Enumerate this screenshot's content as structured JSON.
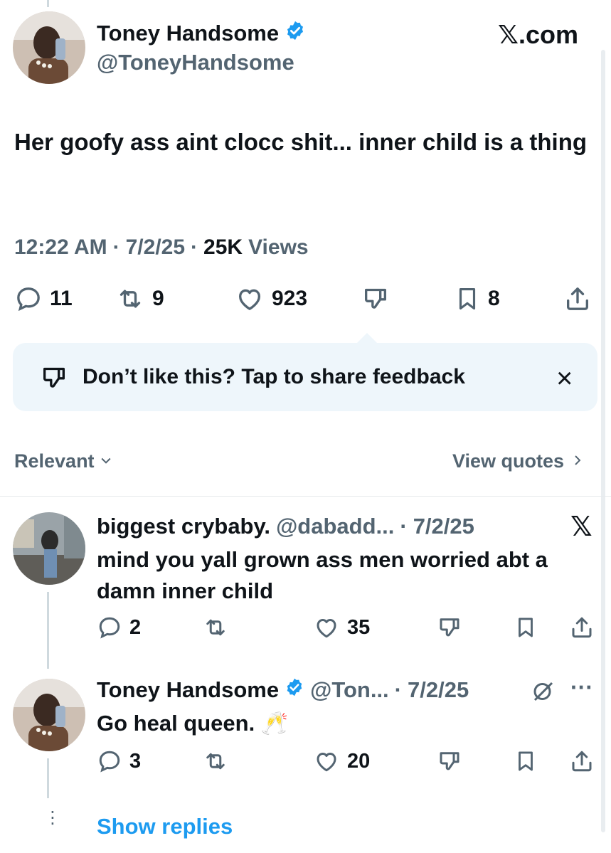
{
  "brand": {
    "site": "𝕏.com"
  },
  "main_post": {
    "author": {
      "name": "Toney Handsome",
      "handle": "@ToneyHandsome",
      "verified": true
    },
    "text": "Her goofy ass aint clocc shit... inner child is a thing",
    "meta": {
      "time": "12:22 AM",
      "date": "7/2/25",
      "views_count": "25K",
      "views_label": "Views",
      "sep": "·"
    },
    "actions": {
      "replies": "11",
      "reposts": "9",
      "likes": "923",
      "bookmarks": "8"
    }
  },
  "feedback": {
    "text": "Don’t like this? Tap to share feedback",
    "close": "×"
  },
  "sort": {
    "label": "Relevant",
    "view_quotes": "View quotes"
  },
  "replies": [
    {
      "author": "biggest crybaby.",
      "handle": "@dabadd...",
      "date": "7/2/25",
      "text_line1": "mind you yall grown ass men worried abt a",
      "text_line2": "damn inner child",
      "actions": {
        "replies": "2",
        "reposts": "",
        "likes": "35"
      }
    },
    {
      "author": "Toney Handsome",
      "handle": "@Ton...",
      "date": "7/2/25",
      "text": "Go heal queen. 🥂",
      "actions": {
        "replies": "3",
        "reposts": "",
        "likes": "20"
      }
    }
  ],
  "show_replies": "Show replies",
  "colors": {
    "accent": "#1d9bf0",
    "muted": "#536471",
    "feedback_bg": "#eef6fb"
  }
}
